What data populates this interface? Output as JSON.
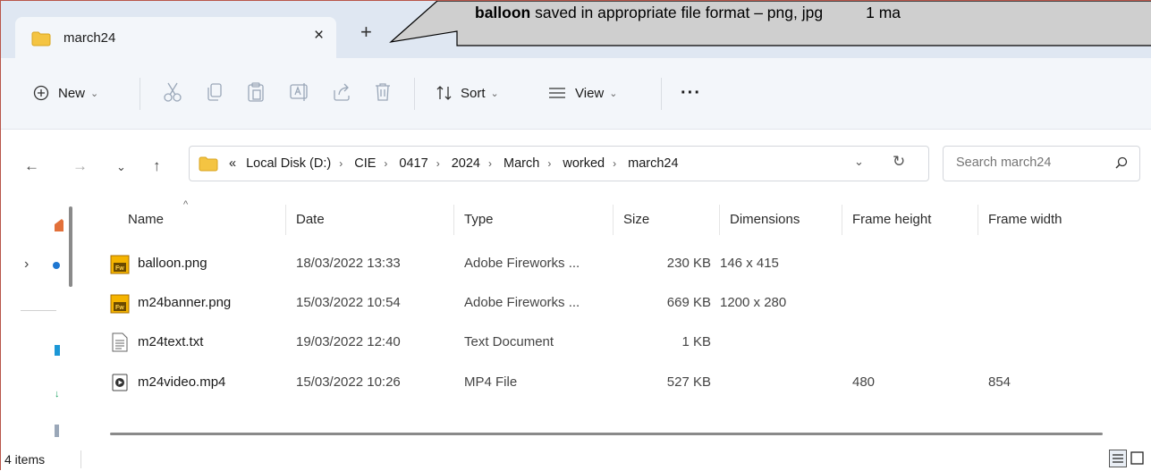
{
  "tab": {
    "title": "march24",
    "close": "×",
    "new": "+"
  },
  "callout": {
    "bold": "balloon",
    "rest": " saved in appropriate file format – png, jpg",
    "marks": "1 ma"
  },
  "toolbar": {
    "new_label": "New",
    "sort_label": "Sort",
    "view_label": "View",
    "more_label": "···",
    "icons": [
      "cut-icon",
      "copy-icon",
      "paste-icon",
      "rename-icon",
      "share-icon",
      "delete-icon"
    ]
  },
  "address": {
    "overflow": "«",
    "crumbs": [
      "Local Disk (D:)",
      "CIE",
      "0417",
      "2024",
      "March",
      "worked",
      "march24"
    ]
  },
  "search": {
    "placeholder": "Search march24"
  },
  "columns": {
    "name": "Name",
    "date": "Date",
    "type": "Type",
    "size": "Size",
    "dimensions": "Dimensions",
    "frame_height": "Frame height",
    "frame_width": "Frame width"
  },
  "files": [
    {
      "name": "balloon.png",
      "date": "18/03/2022 13:33",
      "type": "Adobe Fireworks ...",
      "size": "230 KB",
      "dimensions": "146 x 415",
      "frame_height": "",
      "frame_width": "",
      "icon": "fireworks-icon"
    },
    {
      "name": "m24banner.png",
      "date": "15/03/2022 10:54",
      "type": "Adobe Fireworks ...",
      "size": "669 KB",
      "dimensions": "1200 x 280",
      "frame_height": "",
      "frame_width": "",
      "icon": "fireworks-icon"
    },
    {
      "name": "m24text.txt",
      "date": "19/03/2022 12:40",
      "type": "Text Document",
      "size": "1 KB",
      "dimensions": "",
      "frame_height": "",
      "frame_width": "",
      "icon": "text-file-icon"
    },
    {
      "name": "m24video.mp4",
      "date": "15/03/2022 10:26",
      "type": "MP4 File",
      "size": "527 KB",
      "dimensions": "",
      "frame_height": "480",
      "frame_width": "854",
      "icon": "video-file-icon"
    }
  ],
  "status": {
    "count": "4 items"
  },
  "colors": {
    "tabstrip": "#dfe7f2",
    "toolbar": "#f3f6fa",
    "folder": "#f4c442",
    "fireworks": "#c98a00"
  }
}
